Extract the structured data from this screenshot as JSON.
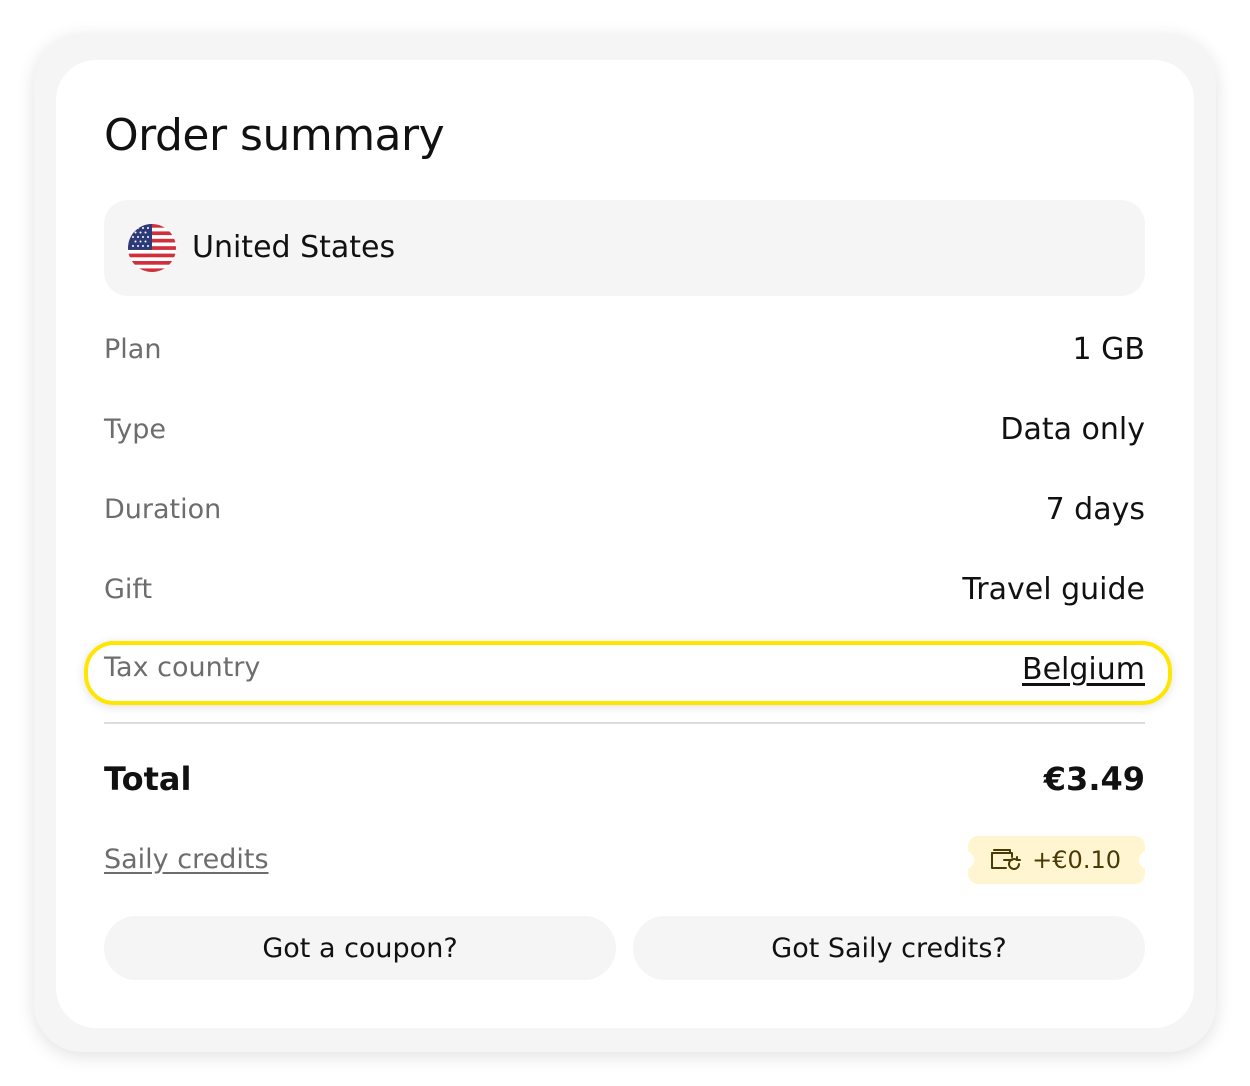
{
  "summary": {
    "title": "Order summary",
    "country": {
      "name": "United States",
      "flag_icon": "us-flag-icon"
    },
    "rows": [
      {
        "label": "Plan",
        "value": "1 GB"
      },
      {
        "label": "Type",
        "value": "Data only"
      },
      {
        "label": "Duration",
        "value": "7 days"
      },
      {
        "label": "Gift",
        "value": "Travel guide"
      }
    ],
    "tax": {
      "label": "Tax country",
      "value": "Belgium",
      "highlight_color": "#ffe600"
    },
    "total": {
      "label": "Total",
      "value": "€3.49"
    },
    "credits": {
      "link_label": "Saily credits",
      "amount": "+€0.10",
      "badge_color": "#fff6d1",
      "icon": "wallet-refresh-icon"
    },
    "buttons": {
      "coupon": "Got a coupon?",
      "credits": "Got Saily credits?"
    }
  }
}
